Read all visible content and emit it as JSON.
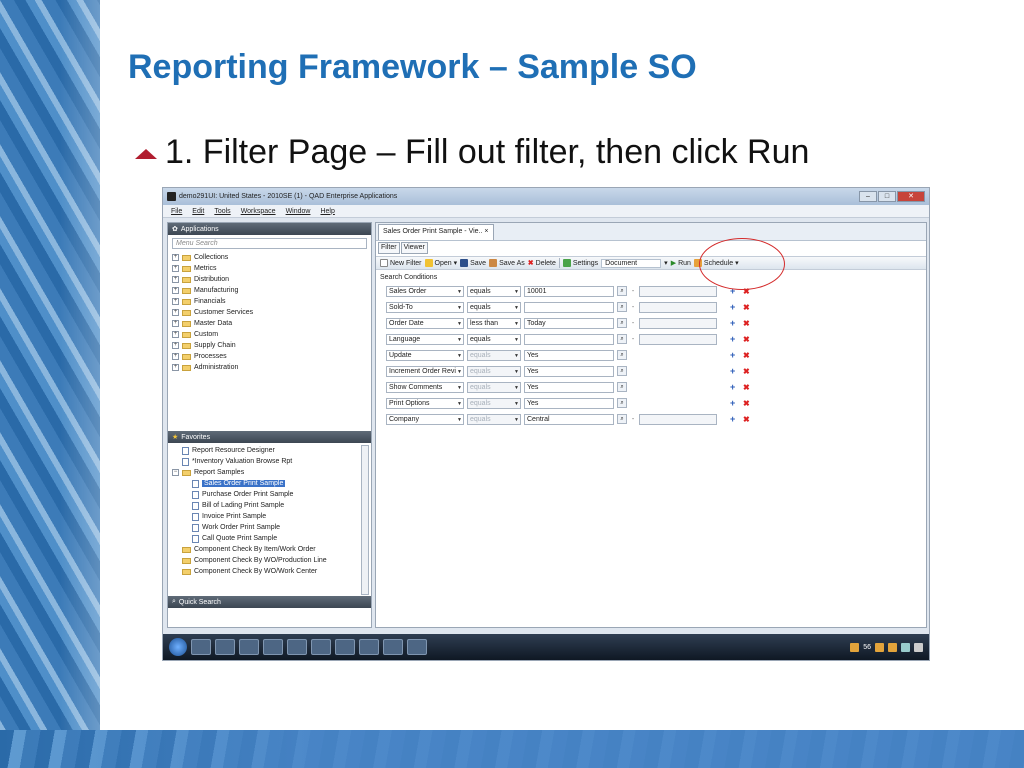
{
  "slide": {
    "title": "Reporting Framework – Sample SO",
    "bullet": "1.  Filter Page – Fill out filter, then click Run"
  },
  "window": {
    "title": "demo291UI: United States - 2010SE (1) - QAD Enterprise Applications",
    "min_btn": "–",
    "max_btn": "□",
    "close_btn": "✕"
  },
  "menu": [
    "File",
    "Edit",
    "Tools",
    "Workspace",
    "Window",
    "Help"
  ],
  "applications": {
    "header": "Applications",
    "search_placeholder": "Menu Search",
    "items": [
      "Collections",
      "Metrics",
      "Distribution",
      "Manufacturing",
      "Financials",
      "Customer Services",
      "Master Data",
      "Custom",
      "Supply Chain",
      "Processes",
      "Administration"
    ]
  },
  "favorites": {
    "header": "Favorites",
    "items": [
      {
        "label": "Report Resource Designer"
      },
      {
        "label": "*Inventory Valuation Browse Rpt"
      },
      {
        "label": "Report Samples"
      },
      {
        "label": "Sales Order Print Sample"
      },
      {
        "label": "Purchase Order Print Sample"
      },
      {
        "label": "Bill of Lading Print Sample"
      },
      {
        "label": "Invoice Print Sample"
      },
      {
        "label": "Work Order Print Sample"
      },
      {
        "label": "Call Quote Print Sample"
      },
      {
        "label": "Component Check By Item/Work Order"
      },
      {
        "label": "Component Check By WO/Production Line"
      },
      {
        "label": "Component Check By WO/Work Center"
      }
    ]
  },
  "quick_search": {
    "header": "Quick Search"
  },
  "document": {
    "tab_label": "Sales Order Print Sample - Vie..",
    "tab_close": "×",
    "subtabs": [
      "Filter",
      "Viewer"
    ],
    "toolbar": {
      "new_filter": "New Filter",
      "open": "Open",
      "save": "Save",
      "save_as": "Save As",
      "delete": "Delete",
      "settings": "Settings",
      "doc_select": "Document",
      "run": "Run",
      "schedule": "Schedule"
    },
    "search_conditions_label": "Search Conditions",
    "conditions": [
      {
        "field": "Sales Order",
        "op": "equals",
        "value": "10001",
        "range": true,
        "op_enabled": true
      },
      {
        "field": "Sold-To",
        "op": "equals",
        "value": "",
        "range": true,
        "op_enabled": true
      },
      {
        "field": "Order Date",
        "op": "less than",
        "value": "Today",
        "range": true,
        "op_enabled": true
      },
      {
        "field": "Language",
        "op": "equals",
        "value": "",
        "range": true,
        "op_enabled": true
      },
      {
        "field": "Update",
        "op": "equals",
        "value": "Yes",
        "range": false,
        "op_enabled": false
      },
      {
        "field": "Increment Order Revi",
        "op": "equals",
        "value": "Yes",
        "range": false,
        "op_enabled": false
      },
      {
        "field": "Show Comments",
        "op": "equals",
        "value": "Yes",
        "range": false,
        "op_enabled": false
      },
      {
        "field": "Print Options",
        "op": "equals",
        "value": "Yes",
        "range": false,
        "op_enabled": false
      },
      {
        "field": "Company",
        "op": "equals",
        "value": "Central",
        "range": true,
        "op_enabled": false
      }
    ]
  },
  "taskbar": {
    "tray_count": "56"
  }
}
